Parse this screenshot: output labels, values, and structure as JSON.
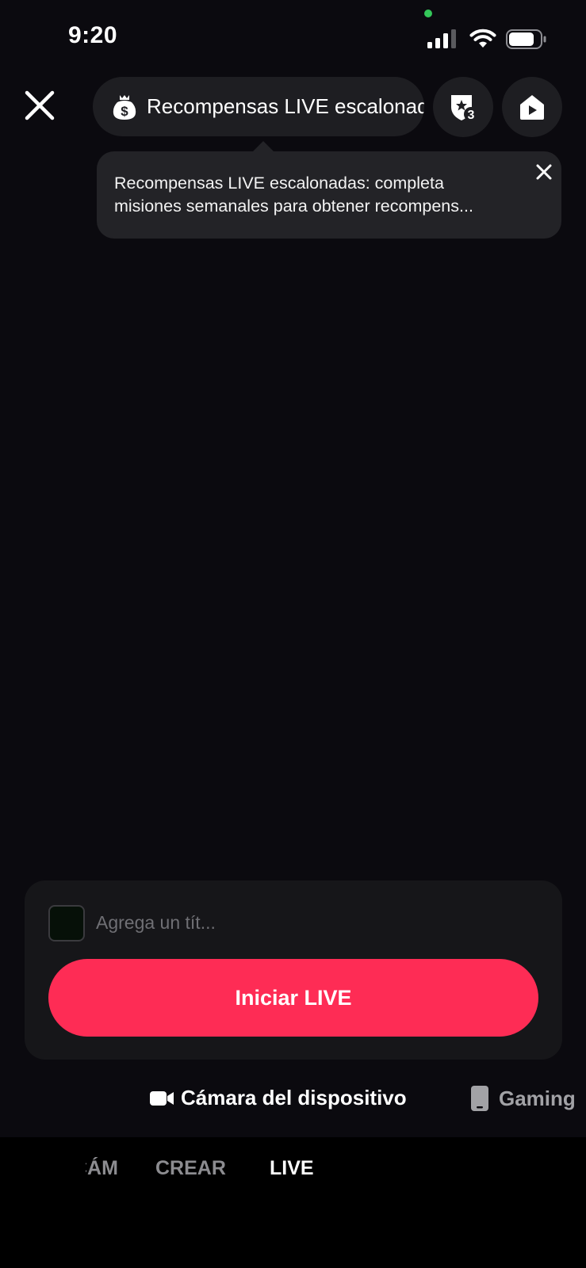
{
  "status_bar": {
    "time": "9:20"
  },
  "top_bar": {
    "rewards_pill_label": "Recompensas LIVE escalonadas",
    "badge_count": "3"
  },
  "tooltip": {
    "line1": "Recompensas LIVE escalonadas: completa",
    "line2": "misiones semanales para obtener recompens..."
  },
  "setup_panel": {
    "title_placeholder": "Agrega un tít...",
    "go_live_label": "Iniciar LIVE"
  },
  "sources": {
    "camera_label": "Cámara del dispositivo",
    "gaming_label": "Gaming"
  },
  "mode_tabs": {
    "prev_label": "CÁMARA",
    "create_label": "CREAR",
    "live_label": "LIVE"
  },
  "colors": {
    "accent": "#fe2c55",
    "background": "#0b0a0f",
    "surface": "#1e1e22",
    "status_dot": "#34c759"
  },
  "icons": {
    "close": "close-icon",
    "rewards": "money-bag-icon",
    "badge": "rank-badge-icon",
    "share": "share-icon",
    "camera": "video-camera-icon",
    "gaming": "phone-icon"
  }
}
